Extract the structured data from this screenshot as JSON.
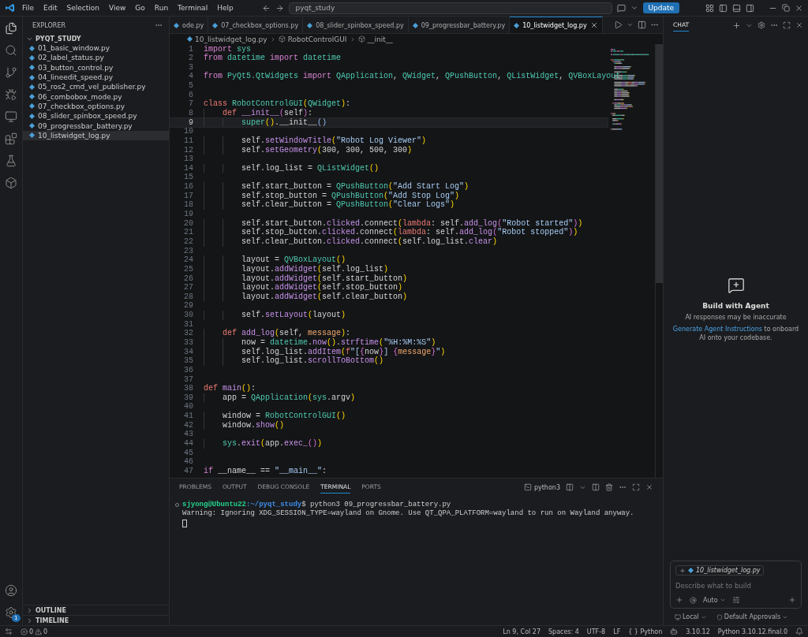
{
  "menu": [
    "File",
    "Edit",
    "Selection",
    "View",
    "Go",
    "Run",
    "Terminal",
    "Help"
  ],
  "command_center": {
    "value": "pyqt_study"
  },
  "update_button": "Update",
  "settings_badge": "1",
  "explorer": {
    "title": "EXPLORER",
    "folder": "PYQT_STUDY",
    "expanded": true,
    "files": [
      {
        "name": "01_basic_window.py",
        "selected": false
      },
      {
        "name": "02_label_status.py",
        "selected": false
      },
      {
        "name": "03_button_control.py",
        "selected": false
      },
      {
        "name": "04_lineedit_speed.py",
        "selected": false
      },
      {
        "name": "05_ros2_cmd_vel_publisher.py",
        "selected": false
      },
      {
        "name": "06_combobox_mode.py",
        "selected": false
      },
      {
        "name": "07_checkbox_options.py",
        "selected": false
      },
      {
        "name": "08_slider_spinbox_speed.py",
        "selected": false
      },
      {
        "name": "09_progressbar_battery.py",
        "selected": false
      },
      {
        "name": "10_listwidget_log.py",
        "selected": true
      }
    ],
    "sections": [
      {
        "label": "OUTLINE",
        "expanded": false
      },
      {
        "label": "TIMELINE",
        "expanded": false
      }
    ]
  },
  "tabs": [
    {
      "label": "ode.py",
      "selected": false
    },
    {
      "label": "07_checkbox_options.py",
      "selected": false
    },
    {
      "label": "08_slider_spinbox_speed.py",
      "selected": false
    },
    {
      "label": "09_progressbar_battery.py",
      "selected": false
    },
    {
      "label": "10_listwidget_log.py",
      "selected": true
    }
  ],
  "breadcrumb": [
    {
      "label": "10_listwidget_log.py",
      "kind": "file"
    },
    {
      "label": "RobotControlGUI",
      "kind": "class"
    },
    {
      "label": "__init__",
      "kind": "method"
    }
  ],
  "code": [
    {
      "number": "1",
      "current": false,
      "tokens": [
        {
          "text": "import",
          "kind": "k"
        },
        {
          "text": " sys",
          "kind": "t"
        }
      ]
    },
    {
      "number": "2",
      "current": false,
      "tokens": [
        {
          "text": "from",
          "kind": "k"
        },
        {
          "text": " datetime",
          "kind": "t"
        },
        {
          "text": " import",
          "kind": "k"
        },
        {
          "text": " datetime",
          "kind": "t"
        }
      ]
    },
    {
      "number": "3",
      "current": false
    },
    {
      "number": "4",
      "current": false,
      "tokens": [
        {
          "text": "from",
          "kind": "k"
        },
        {
          "text": " PyQt5.QtWidgets",
          "kind": "t"
        },
        {
          "text": " import",
          "kind": "k"
        },
        {
          "text": " QApplication",
          "kind": "t"
        },
        {
          "text": ", ",
          "kind": "n"
        },
        {
          "text": "QWidget",
          "kind": "t"
        },
        {
          "text": ", ",
          "kind": "n"
        },
        {
          "text": "QPushButton",
          "kind": "t"
        },
        {
          "text": ", ",
          "kind": "n"
        },
        {
          "text": "QListWidget",
          "kind": "t"
        },
        {
          "text": ", ",
          "kind": "n"
        },
        {
          "text": "QVBoxLayout",
          "kind": "t"
        }
      ]
    },
    {
      "number": "5",
      "current": false
    },
    {
      "number": "6",
      "current": false
    },
    {
      "number": "7",
      "current": false,
      "tokens": [
        {
          "text": "class",
          "kind": "d"
        },
        {
          "text": " RobotControlGUI",
          "kind": "t"
        },
        {
          "text": "(",
          "kind": "b"
        },
        {
          "text": "QWidget",
          "kind": "t"
        },
        {
          "text": ")",
          "kind": "b"
        },
        {
          "text": ":",
          "kind": "n"
        }
      ]
    },
    {
      "number": "8",
      "current": false,
      "tokens": [
        {
          "text": "    def",
          "kind": "d"
        },
        {
          "text": " __init__",
          "kind": "f"
        },
        {
          "text": "(",
          "kind": "b2"
        },
        {
          "text": "self",
          "kind": "n"
        },
        {
          "text": ")",
          "kind": "b2"
        },
        {
          "text": ":",
          "kind": "n"
        }
      ]
    },
    {
      "number": "9",
      "current": true,
      "tokens": [
        {
          "text": "        super",
          "kind": "t"
        },
        {
          "text": "()",
          "kind": "b"
        },
        {
          "text": ".__init__",
          "kind": "n"
        },
        {
          "text": "()",
          "kind": "m"
        }
      ]
    },
    {
      "number": "10",
      "current": false
    },
    {
      "number": "11",
      "current": false,
      "tokens": [
        {
          "text": "        self.",
          "kind": "n"
        },
        {
          "text": "setWindowTitle",
          "kind": "f"
        },
        {
          "text": "(",
          "kind": "b"
        },
        {
          "text": "\"Robot Log Viewer\"",
          "kind": "s"
        },
        {
          "text": ")",
          "kind": "b"
        }
      ]
    },
    {
      "number": "12",
      "current": false,
      "tokens": [
        {
          "text": "        self.",
          "kind": "n"
        },
        {
          "text": "setGeometry",
          "kind": "f"
        },
        {
          "text": "(",
          "kind": "b"
        },
        {
          "text": "300, 300, 500, 300",
          "kind": "n"
        },
        {
          "text": ")",
          "kind": "b"
        }
      ]
    },
    {
      "number": "13",
      "current": false
    },
    {
      "number": "14",
      "current": false,
      "tokens": [
        {
          "text": "        self.log_list = ",
          "kind": "n"
        },
        {
          "text": "QListWidget",
          "kind": "t"
        },
        {
          "text": "()",
          "kind": "b"
        }
      ]
    },
    {
      "number": "15",
      "current": false
    },
    {
      "number": "16",
      "current": false,
      "tokens": [
        {
          "text": "        self.start_button = ",
          "kind": "n"
        },
        {
          "text": "QPushButton",
          "kind": "t"
        },
        {
          "text": "(",
          "kind": "b"
        },
        {
          "text": "\"Add Start Log\"",
          "kind": "s"
        },
        {
          "text": ")",
          "kind": "b"
        }
      ]
    },
    {
      "number": "17",
      "current": false,
      "tokens": [
        {
          "text": "        self.stop_button = ",
          "kind": "n"
        },
        {
          "text": "QPushButton",
          "kind": "t"
        },
        {
          "text": "(",
          "kind": "b"
        },
        {
          "text": "\"Add Stop Log\"",
          "kind": "s"
        },
        {
          "text": ")",
          "kind": "b"
        }
      ]
    },
    {
      "number": "18",
      "current": false,
      "tokens": [
        {
          "text": "        self.clear_button = ",
          "kind": "n"
        },
        {
          "text": "QPushButton",
          "kind": "t"
        },
        {
          "text": "(",
          "kind": "b"
        },
        {
          "text": "\"Clear Logs\"",
          "kind": "s"
        },
        {
          "text": ")",
          "kind": "b"
        }
      ]
    },
    {
      "number": "19",
      "current": false
    },
    {
      "number": "20",
      "current": false,
      "tokens": [
        {
          "text": "        self.start_button.",
          "kind": "n"
        },
        {
          "text": "clicked",
          "kind": "f"
        },
        {
          "text": ".connect",
          "kind": "n"
        },
        {
          "text": "(",
          "kind": "b"
        },
        {
          "text": "lambda",
          "kind": "d"
        },
        {
          "text": ": self.",
          "kind": "n"
        },
        {
          "text": "add_log",
          "kind": "f"
        },
        {
          "text": "(",
          "kind": "b2"
        },
        {
          "text": "\"Robot started\"",
          "kind": "s"
        },
        {
          "text": ")",
          "kind": "b2"
        },
        {
          "text": ")",
          "kind": "b"
        }
      ]
    },
    {
      "number": "21",
      "current": false,
      "tokens": [
        {
          "text": "        self.stop_button.",
          "kind": "n"
        },
        {
          "text": "clicked",
          "kind": "f"
        },
        {
          "text": ".connect",
          "kind": "n"
        },
        {
          "text": "(",
          "kind": "b"
        },
        {
          "text": "lambda",
          "kind": "d"
        },
        {
          "text": ": self.",
          "kind": "n"
        },
        {
          "text": "add_log",
          "kind": "f"
        },
        {
          "text": "(",
          "kind": "b2"
        },
        {
          "text": "\"Robot stopped\"",
          "kind": "s"
        },
        {
          "text": ")",
          "kind": "b2"
        },
        {
          "text": ")",
          "kind": "b"
        }
      ]
    },
    {
      "number": "22",
      "current": false,
      "tokens": [
        {
          "text": "        self.clear_button.",
          "kind": "n"
        },
        {
          "text": "clicked",
          "kind": "f"
        },
        {
          "text": ".connect",
          "kind": "n"
        },
        {
          "text": "(",
          "kind": "b"
        },
        {
          "text": "self.log_list.",
          "kind": "n"
        },
        {
          "text": "clear",
          "kind": "f"
        },
        {
          "text": ")",
          "kind": "b"
        }
      ]
    },
    {
      "number": "23",
      "current": false
    },
    {
      "number": "24",
      "current": false,
      "tokens": [
        {
          "text": "        layout = ",
          "kind": "n"
        },
        {
          "text": "QVBoxLayout",
          "kind": "t"
        },
        {
          "text": "()",
          "kind": "b"
        }
      ]
    },
    {
      "number": "25",
      "current": false,
      "tokens": [
        {
          "text": "        layout.",
          "kind": "n"
        },
        {
          "text": "addWidget",
          "kind": "f"
        },
        {
          "text": "(",
          "kind": "b"
        },
        {
          "text": "self.log_list",
          "kind": "n"
        },
        {
          "text": ")",
          "kind": "b"
        }
      ]
    },
    {
      "number": "26",
      "current": false,
      "tokens": [
        {
          "text": "        layout.",
          "kind": "n"
        },
        {
          "text": "addWidget",
          "kind": "f"
        },
        {
          "text": "(",
          "kind": "b"
        },
        {
          "text": "self.start_button",
          "kind": "n"
        },
        {
          "text": ")",
          "kind": "b"
        }
      ]
    },
    {
      "number": "27",
      "current": false,
      "tokens": [
        {
          "text": "        layout.",
          "kind": "n"
        },
        {
          "text": "addWidget",
          "kind": "f"
        },
        {
          "text": "(",
          "kind": "b"
        },
        {
          "text": "self.stop_button",
          "kind": "n"
        },
        {
          "text": ")",
          "kind": "b"
        }
      ]
    },
    {
      "number": "28",
      "current": false,
      "tokens": [
        {
          "text": "        layout.",
          "kind": "n"
        },
        {
          "text": "addWidget",
          "kind": "f"
        },
        {
          "text": "(",
          "kind": "b"
        },
        {
          "text": "self.clear_button",
          "kind": "n"
        },
        {
          "text": ")",
          "kind": "b"
        }
      ]
    },
    {
      "number": "29",
      "current": false
    },
    {
      "number": "30",
      "current": false,
      "tokens": [
        {
          "text": "        self.",
          "kind": "n"
        },
        {
          "text": "setLayout",
          "kind": "f"
        },
        {
          "text": "(",
          "kind": "b"
        },
        {
          "text": "layout",
          "kind": "n"
        },
        {
          "text": ")",
          "kind": "b"
        }
      ]
    },
    {
      "number": "31",
      "current": false
    },
    {
      "number": "32",
      "current": false,
      "tokens": [
        {
          "text": "    def",
          "kind": "d"
        },
        {
          "text": " add_log",
          "kind": "f"
        },
        {
          "text": "(",
          "kind": "b"
        },
        {
          "text": "self, ",
          "kind": "n"
        },
        {
          "text": "message",
          "kind": "p"
        },
        {
          "text": ")",
          "kind": "b"
        },
        {
          "text": ":",
          "kind": "n"
        }
      ]
    },
    {
      "number": "33",
      "current": false,
      "tokens": [
        {
          "text": "        now = ",
          "kind": "n"
        },
        {
          "text": "datetime",
          "kind": "t"
        },
        {
          "text": ".",
          "kind": "n"
        },
        {
          "text": "now",
          "kind": "f"
        },
        {
          "text": "()",
          "kind": "b"
        },
        {
          "text": ".",
          "kind": "n"
        },
        {
          "text": "strftime",
          "kind": "f"
        },
        {
          "text": "(",
          "kind": "b"
        },
        {
          "text": "\"%H:%M:%S\"",
          "kind": "s"
        },
        {
          "text": ")",
          "kind": "b"
        }
      ]
    },
    {
      "number": "34",
      "current": false,
      "tokens": [
        {
          "text": "        self.log_list.",
          "kind": "n"
        },
        {
          "text": "addItem",
          "kind": "f"
        },
        {
          "text": "(",
          "kind": "b"
        },
        {
          "text": "f",
          "kind": "d"
        },
        {
          "text": "\"[",
          "kind": "s"
        },
        {
          "text": "{",
          "kind": "b2"
        },
        {
          "text": "now",
          "kind": "n"
        },
        {
          "text": "}",
          "kind": "b2"
        },
        {
          "text": "] ",
          "kind": "s"
        },
        {
          "text": "{",
          "kind": "b2"
        },
        {
          "text": "message",
          "kind": "p"
        },
        {
          "text": "}",
          "kind": "b2"
        },
        {
          "text": "\"",
          "kind": "s"
        },
        {
          "text": ")",
          "kind": "b"
        }
      ]
    },
    {
      "number": "35",
      "current": false,
      "tokens": [
        {
          "text": "        self.log_list.",
          "kind": "n"
        },
        {
          "text": "scrollToBottom",
          "kind": "f"
        },
        {
          "text": "()",
          "kind": "b"
        }
      ]
    },
    {
      "number": "36",
      "current": false
    },
    {
      "number": "37",
      "current": false
    },
    {
      "number": "38",
      "current": false,
      "tokens": [
        {
          "text": "def",
          "kind": "d"
        },
        {
          "text": " main",
          "kind": "f"
        },
        {
          "text": "()",
          "kind": "b"
        },
        {
          "text": ":",
          "kind": "n"
        }
      ]
    },
    {
      "number": "39",
      "current": false,
      "tokens": [
        {
          "text": "    app = ",
          "kind": "n"
        },
        {
          "text": "QApplication",
          "kind": "t"
        },
        {
          "text": "(",
          "kind": "b"
        },
        {
          "text": "sys",
          "kind": "t"
        },
        {
          "text": ".argv",
          "kind": "n"
        },
        {
          "text": ")",
          "kind": "b"
        }
      ]
    },
    {
      "number": "40",
      "current": false
    },
    {
      "number": "41",
      "current": false,
      "tokens": [
        {
          "text": "    window = ",
          "kind": "n"
        },
        {
          "text": "RobotControlGUI",
          "kind": "t"
        },
        {
          "text": "()",
          "kind": "b"
        }
      ]
    },
    {
      "number": "42",
      "current": false,
      "tokens": [
        {
          "text": "    window.",
          "kind": "n"
        },
        {
          "text": "show",
          "kind": "f"
        },
        {
          "text": "()",
          "kind": "b"
        }
      ]
    },
    {
      "number": "43",
      "current": false
    },
    {
      "number": "44",
      "current": false,
      "tokens": [
        {
          "text": "    sys",
          "kind": "t"
        },
        {
          "text": ".",
          "kind": "n"
        },
        {
          "text": "exit",
          "kind": "f"
        },
        {
          "text": "(",
          "kind": "b"
        },
        {
          "text": "app.",
          "kind": "n"
        },
        {
          "text": "exec_",
          "kind": "f"
        },
        {
          "text": "()",
          "kind": "b2"
        },
        {
          "text": ")",
          "kind": "b"
        }
      ]
    },
    {
      "number": "45",
      "current": false
    },
    {
      "number": "46",
      "current": false
    },
    {
      "number": "47",
      "current": false,
      "tokens": [
        {
          "text": "if",
          "kind": "k"
        },
        {
          "text": " __name__ == ",
          "kind": "n"
        },
        {
          "text": "\"__main__\"",
          "kind": "s"
        },
        {
          "text": ":",
          "kind": "n"
        }
      ]
    }
  ],
  "panel": {
    "tabs": [
      {
        "label": "PROBLEMS",
        "selected": false
      },
      {
        "label": "OUTPUT",
        "selected": false
      },
      {
        "label": "DEBUG CONSOLE",
        "selected": false
      },
      {
        "label": "TERMINAL",
        "selected": true
      },
      {
        "label": "PORTS",
        "selected": false
      }
    ],
    "shell": "python3",
    "terminal": {
      "user": "sjyong@Ubuntu22",
      "path": ":~/pyqt_study",
      "command": "$ python3 09_progressbar_battery.py",
      "output": "Warning: Ignoring XDG_SESSION_TYPE=wayland on Gnome. Use QT_QPA_PLATFORM=wayland to run on Wayland anyway."
    }
  },
  "chat": {
    "title": "CHAT",
    "heading": "Build with Agent",
    "note": "AI responses may be inaccurate",
    "link": "Generate Agent Instructions",
    "hint": " to onboard AI onto your codebase.",
    "attachment": "10_listwidget_log.py",
    "placeholder": "Describe what to build",
    "mode": "Auto",
    "location": "Local",
    "approvals": "Default Approvals"
  },
  "status_bar": {
    "errors": "0",
    "warnings": "0",
    "position": "Ln 9, Col 27",
    "indent": "Spaces: 4",
    "encoding": "UTF-8",
    "eol": "LF",
    "language": "{ } Python",
    "version": "3.10.12",
    "interpreter": "Python 3.10.12.final.0"
  }
}
